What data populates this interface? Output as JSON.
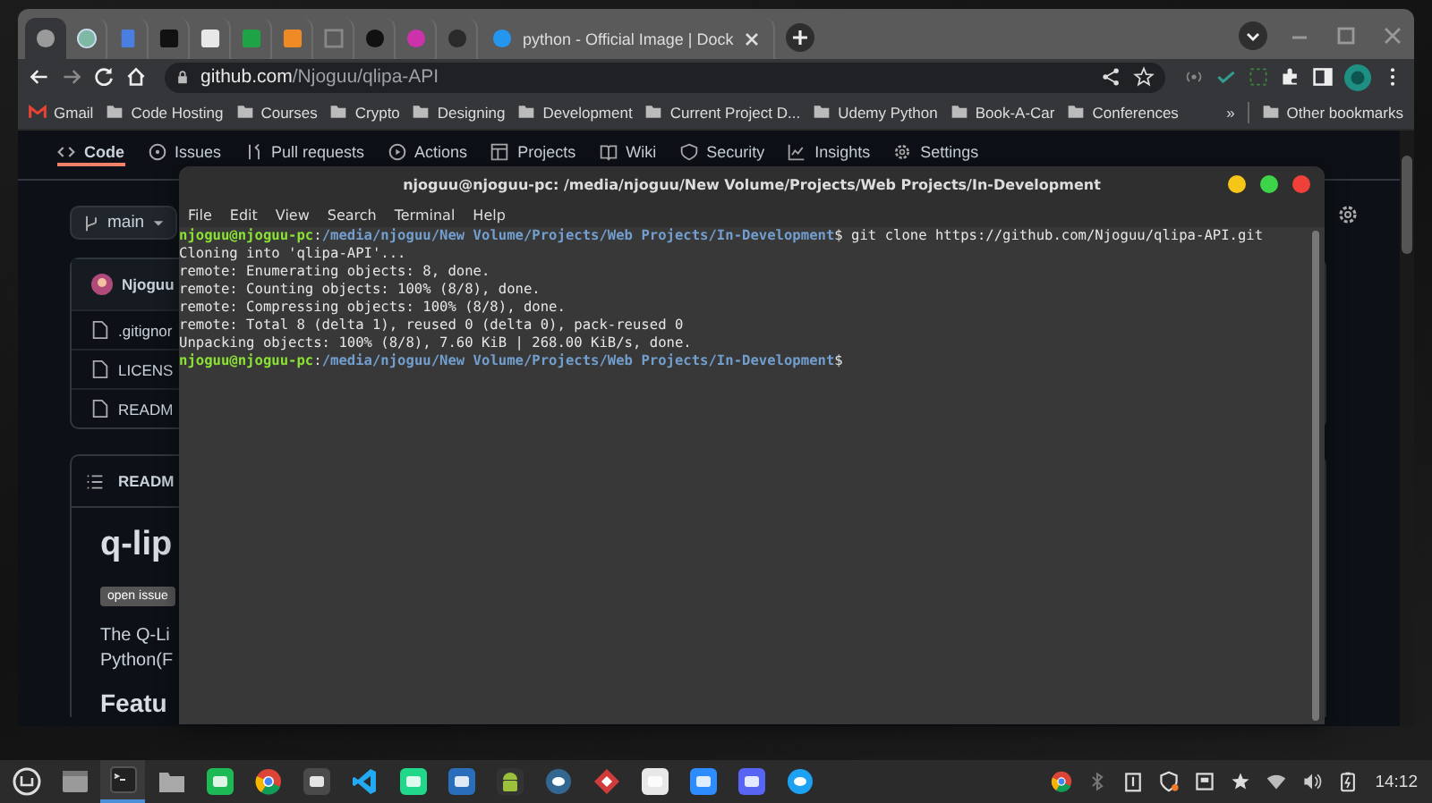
{
  "browser": {
    "tabs": [
      {
        "selected": true
      },
      {
        "selected": false
      },
      {
        "selected": false
      },
      {
        "selected": false
      },
      {
        "selected": false
      },
      {
        "selected": false
      },
      {
        "selected": false
      },
      {
        "selected": false
      },
      {
        "selected": false
      },
      {
        "selected": false
      },
      {
        "selected": false
      },
      {
        "title": "python - Official Image | Dock",
        "selected": false
      }
    ],
    "address": {
      "host": "github.com",
      "path": "/Njoguu/qlipa-API"
    },
    "bookmarks": [
      "Gmail",
      "Code Hosting",
      "Courses",
      "Crypto",
      "Designing",
      "Development",
      "Current Project D...",
      "Udemy Python",
      "Book-A-Car",
      "Conferences"
    ],
    "overflow": "»",
    "other_bookmarks": "Other bookmarks"
  },
  "repo_nav": [
    {
      "label": "Code",
      "selected": true
    },
    {
      "label": "Issues",
      "selected": false
    },
    {
      "label": "Pull requests",
      "selected": false
    },
    {
      "label": "Actions",
      "selected": false
    },
    {
      "label": "Projects",
      "selected": false
    },
    {
      "label": "Wiki",
      "selected": false
    },
    {
      "label": "Security",
      "selected": false
    },
    {
      "label": "Insights",
      "selected": false
    },
    {
      "label": "Settings",
      "selected": false
    }
  ],
  "branch": "main",
  "files": {
    "author": "Njoguu",
    "items": [
      ".gitignor",
      "LICENS",
      "READM"
    ]
  },
  "readme": {
    "header": "READM",
    "title": "q-lip",
    "badge": "open issue",
    "paragraph": [
      "The Q-Li",
      "Python(F"
    ],
    "section": "Featu"
  },
  "terminal": {
    "title": "njoguu@njoguu-pc: /media/njoguu/New Volume/Projects/Web Projects/In-Development",
    "menu": [
      "File",
      "Edit",
      "View",
      "Search",
      "Terminal",
      "Help"
    ],
    "lines": [
      [
        {
          "kind": "user",
          "text": "njoguu@njoguu-pc"
        },
        {
          "kind": "plain",
          "text": ":"
        },
        {
          "kind": "path",
          "text": "/media/njoguu/New Volume/Projects/Web Projects/In-Development"
        },
        {
          "kind": "plain",
          "text": "$ git clone https://github.com/Njoguu/qlipa-API.git"
        }
      ],
      [
        {
          "kind": "plain",
          "text": "Cloning into 'qlipa-API'..."
        }
      ],
      [
        {
          "kind": "plain",
          "text": "remote: Enumerating objects: 8, done."
        }
      ],
      [
        {
          "kind": "plain",
          "text": "remote: Counting objects: 100% (8/8), done."
        }
      ],
      [
        {
          "kind": "plain",
          "text": "remote: Compressing objects: 100% (8/8), done."
        }
      ],
      [
        {
          "kind": "plain",
          "text": "remote: Total 8 (delta 1), reused 0 (delta 0), pack-reused 0"
        }
      ],
      [
        {
          "kind": "plain",
          "text": "Unpacking objects: 100% (8/8), 7.60 KiB | 268.00 KiB/s, done."
        }
      ],
      [
        {
          "kind": "user",
          "text": "njoguu@njoguu-pc"
        },
        {
          "kind": "plain",
          "text": ":"
        },
        {
          "kind": "path",
          "text": "/media/njoguu/New Volume/Projects/Web Projects/In-Development"
        },
        {
          "kind": "plain",
          "text": "$"
        }
      ]
    ]
  },
  "taskbar": {
    "apps": [
      {
        "active": false
      },
      {
        "active": false
      },
      {
        "active": true
      },
      {
        "active": false
      },
      {
        "active": false
      },
      {
        "active": false
      },
      {
        "active": false
      },
      {
        "active": false
      },
      {
        "active": false
      },
      {
        "active": false
      },
      {
        "active": false
      },
      {
        "active": false
      },
      {
        "active": false
      },
      {
        "active": false
      },
      {
        "active": false
      },
      {
        "active": false
      },
      {
        "active": false
      }
    ],
    "clock": "14:12"
  }
}
